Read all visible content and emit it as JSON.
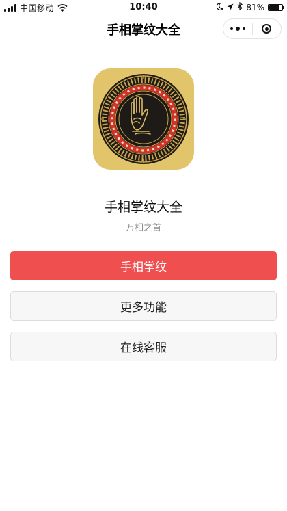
{
  "status_bar": {
    "carrier": "中国移动",
    "time": "10:40",
    "battery": "81%",
    "battery_level": 0.81,
    "icons": [
      "signal-icon",
      "wifi-icon",
      "moon-icon",
      "location-icon",
      "bluetooth-icon",
      "battery-icon"
    ]
  },
  "nav": {
    "title": "手相掌纹大全",
    "icons": [
      "more-icon",
      "close-miniprogram-icon"
    ]
  },
  "app": {
    "name": "手相掌纹大全",
    "slogan": "万相之首",
    "logo_icon": "palm-logo-icon"
  },
  "buttons": {
    "primary": "手相掌纹",
    "more": "更多功能",
    "service": "在线客服"
  },
  "colors": {
    "primary": "#ef4f4f",
    "logo_gold": "#e2c46a",
    "logo_dark": "#1e1a17",
    "logo_red": "#d2322b"
  }
}
